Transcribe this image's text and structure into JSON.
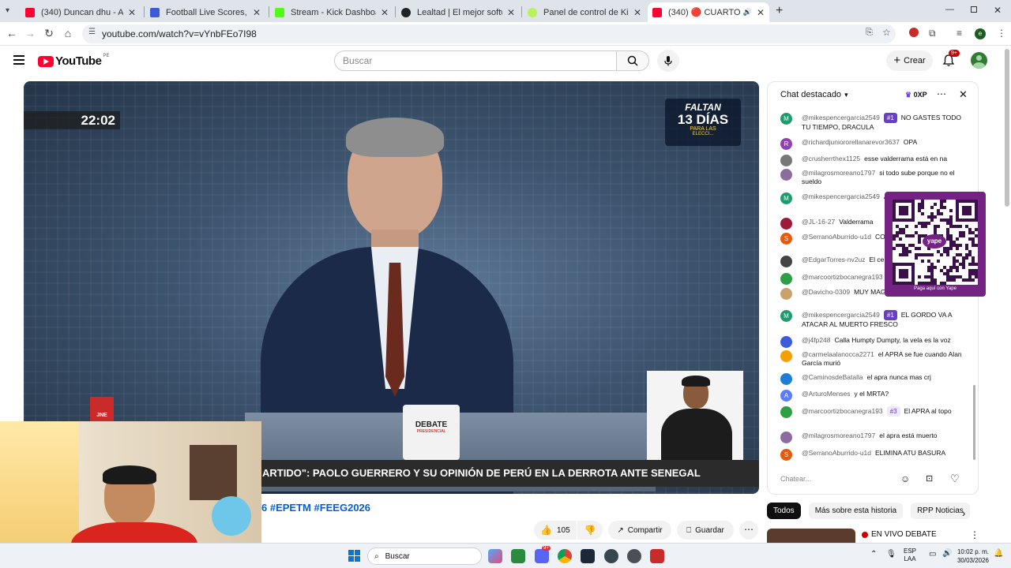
{
  "browser": {
    "tabs": [
      {
        "title": "(340) Duncan dhu - A tientas (I",
        "favicon_color": "#ff0033"
      },
      {
        "title": "Football Live Scores, Fixtures &",
        "favicon_color": "#3b5bdb"
      },
      {
        "title": "Stream - Kick Dashboard",
        "favicon_color": "#53fc18"
      },
      {
        "title": "Lealtad | El mejor software para",
        "favicon_color": "#222222"
      },
      {
        "title": "Panel de control de KickBot",
        "favicon_color": "#b7f35c"
      },
      {
        "title": "(340) 🔴 CUARTO DÍA DEL",
        "favicon_color": "#ff0033"
      }
    ],
    "url": "youtube.com/watch?v=vYnbFEo7I98"
  },
  "youtube": {
    "logo_text": "YouTube",
    "country_code": "PE",
    "search_placeholder": "Buscar",
    "create_label": "Crear",
    "notifications_badge": "9+"
  },
  "video": {
    "clock": "22:02",
    "countdown_top": "FALTAN",
    "countdown_main": "13 DÍAS",
    "countdown_sub": "PARA LAS",
    "countdown_sub2": "ELECCI...",
    "channel_logo": "JNE",
    "ticker": "ARTIDO\": PAOLO GUERRERO Y SU OPINIÓN DE PERÚ EN LA DERROTA ANTE SENEGAL",
    "mug_text": "DEBATE",
    "mug_sub": "PRESIDENCIAL"
  },
  "below_video": {
    "hashtags": "6 #EPETM #FEEG2026",
    "like_count": "105",
    "share_label": "Compartir",
    "save_label": "Guardar"
  },
  "chat": {
    "title": "Chat destacado",
    "points": "0XP",
    "input_placeholder": "Chatear...",
    "messages": [
      {
        "initial": "M",
        "color": "#1f9b6f",
        "author": "@mikespencergarcia2549",
        "badge": "#1",
        "text": "NO GASTES TODO TU TIEMPO, DRACULA"
      },
      {
        "initial": "R",
        "color": "#8e44ad",
        "author": "@richardjuniororellanarevor3637",
        "badge": "",
        "text": "OPA"
      },
      {
        "initial": "",
        "color": "#777777",
        "author": "@crusherrthex1125",
        "badge": "",
        "text": "esse valderrama está en na"
      },
      {
        "initial": "",
        "color": "#8a6d9e",
        "author": "@milagrosmoreano1797",
        "badge": "",
        "text": "si todo sube porque no el sueldo"
      },
      {
        "initial": "M",
        "color": "#1f9b6f",
        "author": "@mikespencergarcia2549",
        "badge": "",
        "text": "A ATACAR"
      },
      {
        "initial": "",
        "color": "#9b1c3a",
        "author": "@JL-16-27",
        "badge": "",
        "text": "Valderrama"
      },
      {
        "initial": "S",
        "color": "#e8590c",
        "author": "@SerranoAburrido-u1d",
        "badge": "",
        "text": "CO COMILON"
      },
      {
        "initial": "",
        "color": "#444444",
        "author": "@EdgarTorres-nv2uz",
        "badge": "",
        "text": "El ce"
      },
      {
        "initial": "",
        "color": "#2f9e44",
        "author": "@marcoortizbocanegra193",
        "badge": "",
        "text": ""
      },
      {
        "initial": "",
        "color": "#c9a36b",
        "author": "@Davicho-0309",
        "badge": "",
        "text": "MUY MAG FRESCO"
      },
      {
        "initial": "M",
        "color": "#1f9b6f",
        "author": "@mikespencergarcia2549",
        "badge": "#1",
        "text": "EL GORDO VA A ATACAR AL MUERTO FRESCO"
      },
      {
        "initial": "",
        "color": "#3b5bdb",
        "author": "@j4fp248",
        "badge": "",
        "text": "Calla Humpty Dumpty, la vela es la voz"
      },
      {
        "initial": "",
        "color": "#f59f00",
        "author": "@carmelaalanocca2271",
        "badge": "",
        "text": "el APRA se fue cuando Alan García murió"
      },
      {
        "initial": "",
        "color": "#1c7ed6",
        "author": "@CaminosdeBatalla",
        "badge": "",
        "text": "el apra nunca mas crj"
      },
      {
        "initial": "A",
        "color": "#5c7cfa",
        "author": "@ArturoMenses",
        "badge": "",
        "text": "y el MRTA?"
      },
      {
        "initial": "",
        "color": "#2f9e44",
        "author": "@marcoortizbocanegra193",
        "badge": "#3",
        "text": "El APRA al topo"
      },
      {
        "initial": "",
        "color": "#8a6d9e",
        "author": "@milagrosmoreano1797",
        "badge": "",
        "text": "el apra está muerto"
      },
      {
        "initial": "S",
        "color": "#e8590c",
        "author": "@SerranoAburrido-u1d",
        "badge": "",
        "text": "ELIMINA ATU BASURA"
      }
    ]
  },
  "qr": {
    "caption": "Paga aquí con Yape",
    "brand": "yape",
    "color": "#742284"
  },
  "related": {
    "chips": [
      "Todos",
      "Más sobre esta historia",
      "RPP Noticias"
    ],
    "live_label": "EN VIVO DEBATE"
  },
  "taskbar": {
    "search_placeholder": "Buscar",
    "lang_top": "ESP",
    "lang_bottom": "LAA",
    "time": "10:02 p. m.",
    "date": "30/03/2026",
    "discord_badge": "9+"
  }
}
